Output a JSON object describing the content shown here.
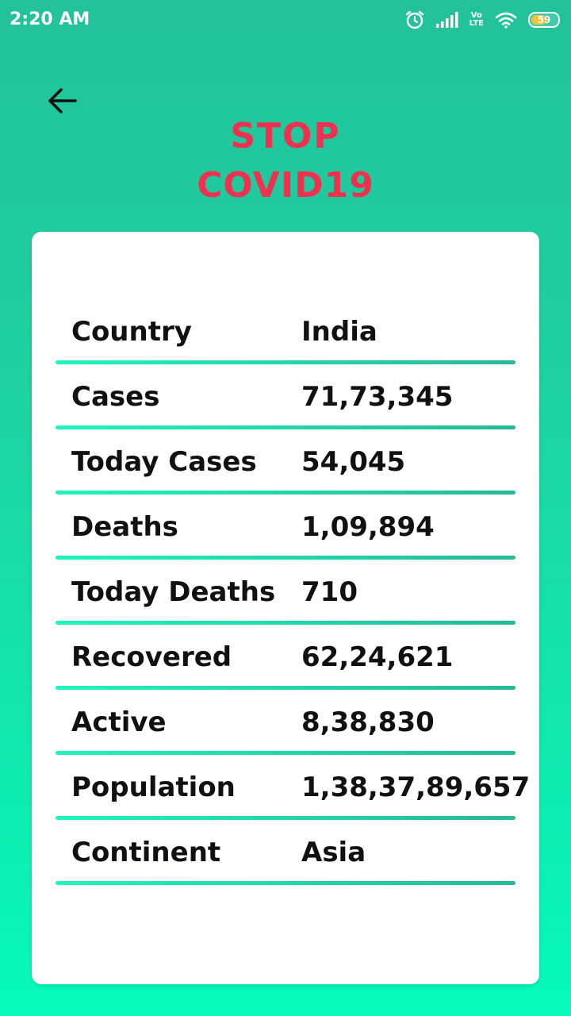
{
  "status_bar": {
    "time": "2:20 AM",
    "icons": [
      "alarm-icon",
      "signal-icon",
      "volte-icon",
      "wifi-icon",
      "battery-icon"
    ],
    "volte_top": "Vo",
    "volte_bottom": "LTE",
    "battery_level": "59"
  },
  "header": {
    "back_icon": "arrow-left-icon",
    "logo": {
      "line1": "STOP",
      "line2": "COVID19",
      "color": "#f0304f"
    }
  },
  "stats": {
    "rows": [
      {
        "label": "Country",
        "value": "India"
      },
      {
        "label": "Cases",
        "value": "71,73,345"
      },
      {
        "label": "Today Cases",
        "value": "54,045"
      },
      {
        "label": "Deaths",
        "value": "1,09,894"
      },
      {
        "label": "Today Deaths",
        "value": "710"
      },
      {
        "label": "Recovered",
        "value": "62,24,621"
      },
      {
        "label": "Active",
        "value": "8,38,830"
      },
      {
        "label": "Population",
        "value": "1,38,37,89,657"
      },
      {
        "label": "Continent",
        "value": "Asia"
      }
    ]
  },
  "colors": {
    "background_top": "#22c29a",
    "background_bottom": "#06fbb9",
    "divider_start": "#1ff5bd",
    "divider_end": "#26b998",
    "text": "#111111"
  }
}
